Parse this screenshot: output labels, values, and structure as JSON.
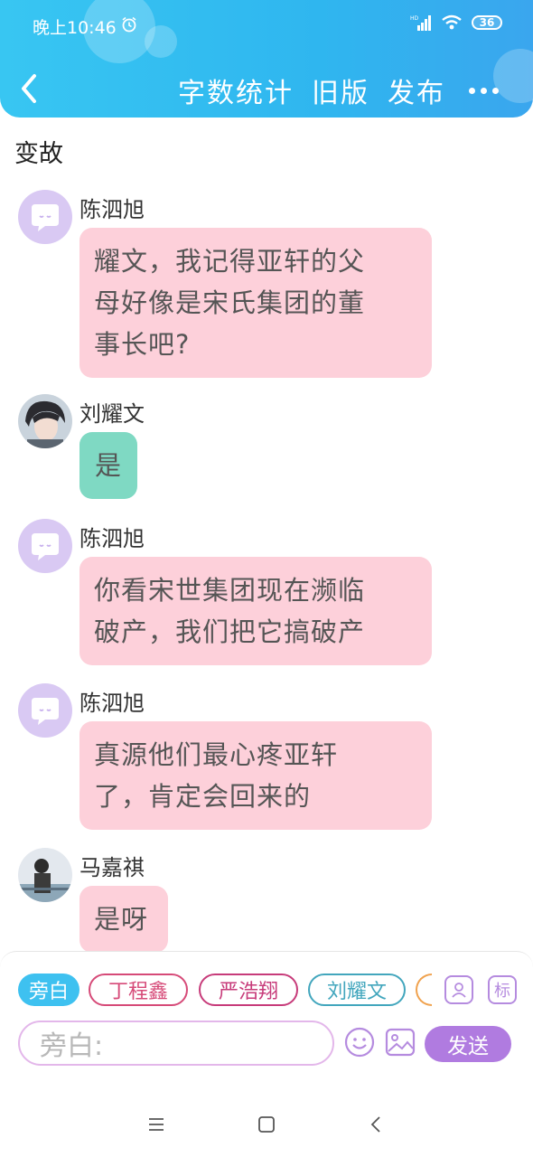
{
  "status_bar": {
    "time": "晚上10:46",
    "battery": "36"
  },
  "header": {
    "actions": [
      "字数统计",
      "旧版",
      "发布"
    ]
  },
  "chapter_title": "变故",
  "messages": [
    {
      "speaker": "陈泗旭",
      "text": "耀文，我记得亚轩的父母好像是宋氏集团的董事长吧？",
      "lines": [
        "耀文，我记得亚轩的父",
        "母好像是宋氏集团的董",
        "事长吧?"
      ]
    },
    {
      "speaker": "刘耀文",
      "text": "是"
    },
    {
      "speaker": "陈泗旭",
      "lines": [
        "你看宋世集团现在濒临",
        "破产，我们把它搞破产"
      ]
    },
    {
      "speaker": "陈泗旭",
      "lines": [
        "真源他们最心疼亚轩",
        "了，肯定会回来的"
      ]
    },
    {
      "speaker": "马嘉祺",
      "text": "是呀"
    }
  ],
  "input": {
    "chips": [
      "旁白",
      "丁程鑫",
      "严浩翔",
      "刘耀文"
    ],
    "placeholder": "旁白:",
    "tag_label": "标",
    "send_label": "发送"
  },
  "colors": {
    "header": "#2fb6ef",
    "bubble_pink": "#fdd0da",
    "bubble_teal": "#7fd9c3",
    "send": "#b07be0"
  }
}
